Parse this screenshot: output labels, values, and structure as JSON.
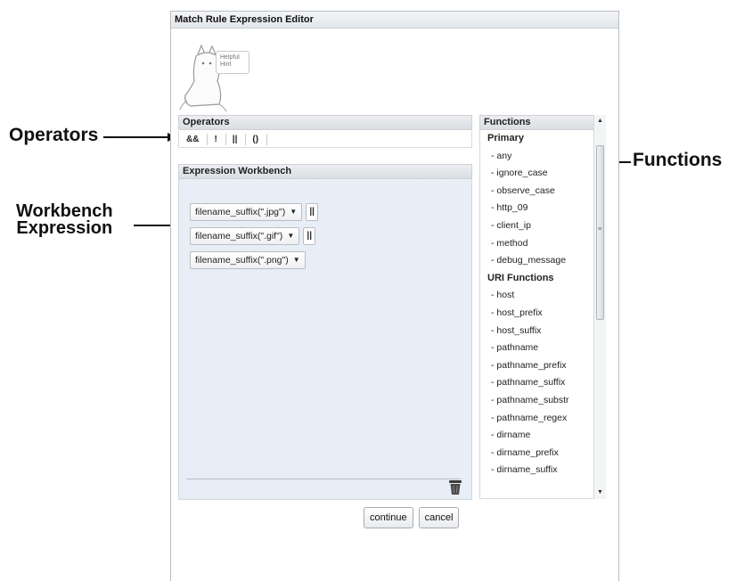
{
  "dialog": {
    "title": "Match Rule Expression Editor"
  },
  "hint": {
    "line1": "Helpful",
    "line2": "Hint"
  },
  "operators": {
    "title": "Operators",
    "items": [
      "&&",
      "!",
      "||",
      "()"
    ]
  },
  "workbench": {
    "title": "Expression Workbench",
    "expressions": [
      {
        "label": "filename_suffix(\".jpg\")",
        "or_label": "||"
      },
      {
        "label": "filename_suffix(\".gif\")",
        "or_label": "||"
      },
      {
        "label": "filename_suffix(\".png\")"
      }
    ]
  },
  "functions": {
    "title": "Functions",
    "groups": [
      {
        "name": "Primary",
        "items": [
          "- any",
          "- ignore_case",
          "- observe_case",
          "- http_09",
          "- client_ip",
          "- method",
          "- debug_message"
        ]
      },
      {
        "name": "URI Functions",
        "items": [
          "- host",
          "- host_prefix",
          "- host_suffix",
          "- pathname",
          "- pathname_prefix",
          "- pathname_suffix",
          "- pathname_substr",
          "- pathname_regex",
          "- dirname",
          "- dirname_prefix",
          "- dirname_suffix"
        ]
      }
    ]
  },
  "buttons": {
    "continue": "continue",
    "cancel": "cancel"
  },
  "callouts": {
    "operators": "Operators",
    "functions": "Functions",
    "workbench_line1": "Workbench",
    "workbench_line2": "Expression"
  }
}
